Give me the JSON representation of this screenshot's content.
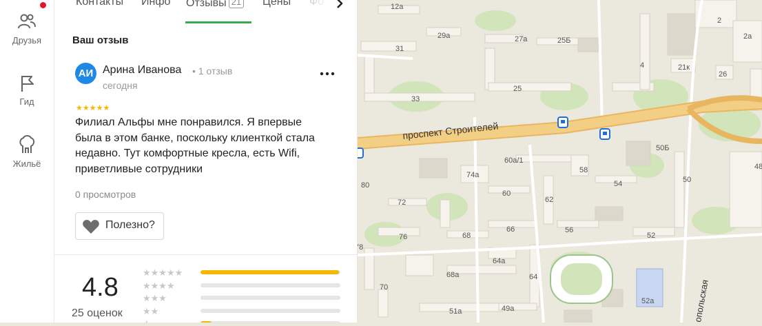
{
  "nav": {
    "items": [
      {
        "label": "Друзья",
        "icon": "friends-icon"
      },
      {
        "label": "Гид",
        "icon": "flag-icon"
      },
      {
        "label": "Жильё",
        "icon": "housing-icon"
      }
    ],
    "notification_color": "#e0182d"
  },
  "tabs": [
    {
      "label": "Контакты"
    },
    {
      "label": "Инфо"
    },
    {
      "label": "Отзывы",
      "count": "21",
      "active": true
    },
    {
      "label": "Цены"
    },
    {
      "label": "Фо"
    }
  ],
  "review": {
    "heading": "Ваш отзыв",
    "avatar_initials": "АИ",
    "author": "Арина Иванова",
    "author_meta": "• 1 отзыв",
    "date": "сегодня",
    "stars": "★★★★★",
    "rating": 5,
    "text": "Филиал Альфы мне понравился. Я впервые была в этом банке, поскольку клиенткой стала недавно. Тут комфортные кресла, есть Wifi, приветливые сотрудники",
    "views": "0 просмотров",
    "useful_label": "Полезно?"
  },
  "rating_summary": {
    "score": "4.8",
    "count": "25 оценок",
    "distribution": [
      {
        "stars": "★★★★★",
        "fraction": 0.99
      },
      {
        "stars": "★★★★",
        "fraction": 0.0
      },
      {
        "stars": "★★★",
        "fraction": 0.0
      },
      {
        "stars": "★★",
        "fraction": 0.0
      },
      {
        "stars": "★",
        "fraction": 0.08
      }
    ]
  },
  "colors": {
    "accent": "#3aa94a",
    "star": "#f7b500",
    "avatar": "#1e88e5",
    "bar": "#f5b800"
  },
  "map": {
    "street_main": "проспект Строителей",
    "street_side": "опольская",
    "labels": [
      "12а",
      "2",
      "29а",
      "27а",
      "25Б",
      "31",
      "4",
      "21к",
      "26",
      "2а",
      "25",
      "33",
      "50Б",
      "60а/1",
      "58",
      "74а",
      "54",
      "50",
      "80",
      "60",
      "62",
      "72",
      "76",
      "68",
      "66",
      "56",
      "52",
      "78",
      "64а",
      "68а",
      "64",
      "70",
      "52а",
      "51а",
      "49а",
      "48"
    ]
  }
}
